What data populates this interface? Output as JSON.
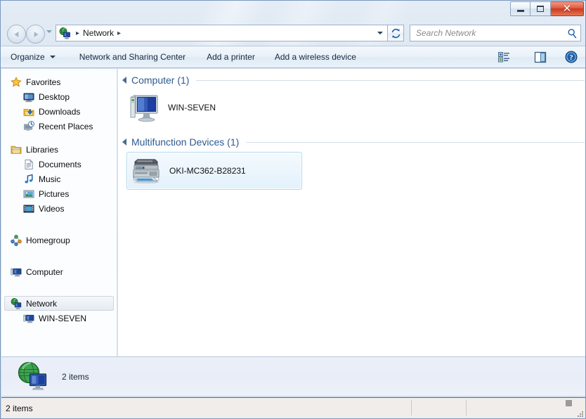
{
  "window": {
    "caption_buttons": [
      {
        "name": "minimize",
        "tooltip": "Minimize"
      },
      {
        "name": "maximize",
        "tooltip": "Maximize"
      },
      {
        "name": "close",
        "glyph": "✕",
        "tooltip": "Close"
      }
    ],
    "frame_color": "#cfdeee",
    "close_color": "#c63a21"
  },
  "address_bar": {
    "back_label": "Back",
    "forward_label": "Forward",
    "history_label": "Recent pages",
    "icon": "network-icon",
    "crumbs": [
      "Network"
    ],
    "separator": "▸",
    "dropdown_label": "Previous locations",
    "refresh_label": "Refresh",
    "search": {
      "placeholder": "Search Network",
      "value": "",
      "icon": "search-icon"
    }
  },
  "command_bar": {
    "items": [
      {
        "label": "Organize",
        "has_caret": true
      },
      {
        "label": "Network and Sharing Center",
        "has_caret": false
      },
      {
        "label": "Add a printer",
        "has_caret": false
      },
      {
        "label": "Add a wireless device",
        "has_caret": false
      }
    ],
    "right_items": [
      {
        "name": "change-view-icon",
        "label": "Change your view",
        "has_caret": true
      },
      {
        "name": "preview-pane-icon",
        "label": "Show the preview pane",
        "has_caret": false
      },
      {
        "name": "help-icon",
        "label": "Get help",
        "has_caret": false
      }
    ]
  },
  "nav_pane": {
    "sections": [
      {
        "header": {
          "label": "Favorites",
          "icon": "star-icon"
        },
        "items": [
          {
            "label": "Desktop",
            "icon": "desktop-icon"
          },
          {
            "label": "Downloads",
            "icon": "downloads-icon"
          },
          {
            "label": "Recent Places",
            "icon": "recent-places-icon"
          }
        ]
      },
      {
        "header": {
          "label": "Libraries",
          "icon": "libraries-icon"
        },
        "items": [
          {
            "label": "Documents",
            "icon": "documents-icon"
          },
          {
            "label": "Music",
            "icon": "music-icon"
          },
          {
            "label": "Pictures",
            "icon": "pictures-icon"
          },
          {
            "label": "Videos",
            "icon": "videos-icon"
          }
        ]
      },
      {
        "header": {
          "label": "Homegroup",
          "icon": "homegroup-icon"
        },
        "items": []
      },
      {
        "header": {
          "label": "Computer",
          "icon": "computer-icon"
        },
        "items": []
      },
      {
        "header": {
          "label": "Network",
          "icon": "network-icon",
          "selected": true
        },
        "items": [
          {
            "label": "WIN-SEVEN",
            "icon": "computer-icon"
          }
        ]
      }
    ]
  },
  "content": {
    "groups": [
      {
        "label": "Computer (1)",
        "expanded": true,
        "items": [
          {
            "label": "WIN-SEVEN",
            "icon": "computer-large-icon",
            "highlighted": false
          }
        ]
      },
      {
        "label": "Multifunction Devices (1)",
        "expanded": true,
        "items": [
          {
            "label": "OKI-MC362-B28231",
            "icon": "printer-large-icon",
            "highlighted": true
          }
        ]
      }
    ]
  },
  "details_pane": {
    "icon": "network-globe-icon",
    "text": "2 items"
  },
  "status_bar": {
    "text": "2 items"
  },
  "colors": {
    "group_header": "#2e5a8f",
    "selection_border": "#b4d9ef",
    "accent": "#2e5a8f"
  }
}
